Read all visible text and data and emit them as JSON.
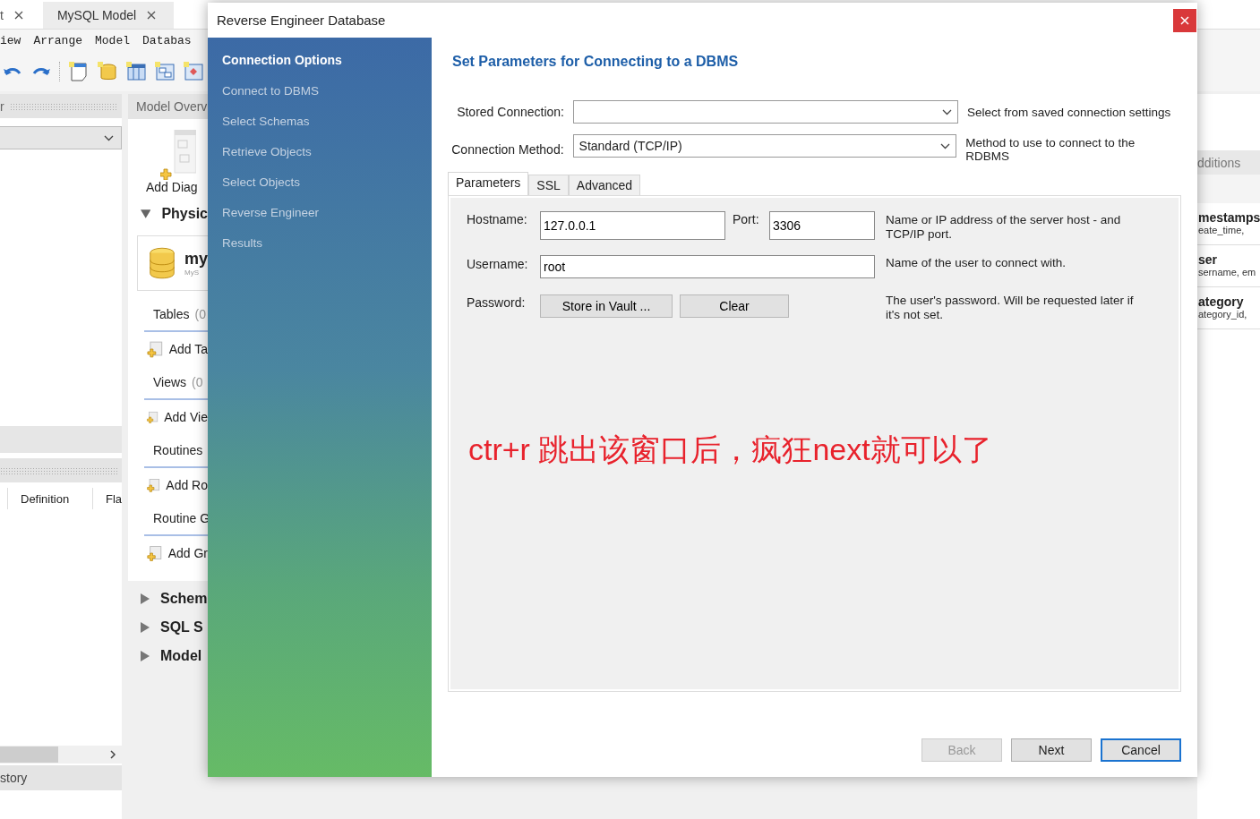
{
  "app": {
    "doc_tabs": [
      {
        "label": "t",
        "selected": false
      },
      {
        "label": "MySQL Model",
        "selected": true
      }
    ],
    "menu": [
      "iew",
      "Arrange",
      "Model",
      "Databas"
    ],
    "left_panel": {
      "header": "r",
      "columns": [
        "Definition",
        "Fla"
      ],
      "bottom_tab": "story"
    },
    "overview": {
      "header": "Model Overv",
      "add_diagram": "Add Diag",
      "sections": [
        {
          "label": "Physic",
          "expanded": true
        },
        {
          "label": "Schem",
          "expanded": false
        },
        {
          "label": "SQL S",
          "expanded": false
        },
        {
          "label": "Model",
          "expanded": false
        }
      ],
      "schema": {
        "name": "my",
        "subtitle": "MyS"
      },
      "groups": [
        {
          "label": "Tables",
          "count": "(0",
          "add": "Add Ta"
        },
        {
          "label": "Views",
          "count": "(0",
          "add": "Add Vie"
        },
        {
          "label": "Routines",
          "add": "Add Ro"
        },
        {
          "label": "Routine G",
          "add": "Add Gr"
        }
      ]
    },
    "right_panel": {
      "header": "dditions",
      "items": [
        {
          "title": "mestamps",
          "detail": "eate_time,"
        },
        {
          "title": "ser",
          "detail": "sername, em"
        },
        {
          "title": "ategory",
          "detail": "ategory_id,"
        }
      ]
    }
  },
  "dialog": {
    "title": "Reverse Engineer Database",
    "steps": [
      {
        "label": "Connection Options",
        "selected": true
      },
      {
        "label": "Connect to DBMS",
        "selected": false
      },
      {
        "label": "Select Schemas",
        "selected": false
      },
      {
        "label": "Retrieve Objects",
        "selected": false
      },
      {
        "label": "Select Objects",
        "selected": false
      },
      {
        "label": "Reverse Engineer",
        "selected": false
      },
      {
        "label": "Results",
        "selected": false
      }
    ],
    "heading": "Set Parameters for Connecting to a DBMS",
    "stored_connection": {
      "label": "Stored Connection:",
      "help": "Select from saved connection settings"
    },
    "connection_method": {
      "label": "Connection Method:",
      "value": "Standard (TCP/IP)",
      "help": "Method to use to connect to the RDBMS"
    },
    "tabs": [
      {
        "label": "Parameters",
        "selected": true
      },
      {
        "label": "SSL",
        "selected": false
      },
      {
        "label": "Advanced",
        "selected": false
      }
    ],
    "hostname": {
      "label": "Hostname:",
      "value": "127.0.0.1"
    },
    "port": {
      "label": "Port:",
      "value": "3306"
    },
    "host_help": "Name or IP address of the server host - and TCP/IP port.",
    "username": {
      "label": "Username:",
      "value": "root",
      "help": "Name of the user to connect with."
    },
    "password": {
      "label": "Password:",
      "buttons": [
        "Store in Vault ...",
        "Clear"
      ],
      "help": "The user's password. Will be requested later if it's not set."
    },
    "annotation": "ctr+r  跳出该窗口后，疯狂next就可以了",
    "buttons": [
      {
        "label": "Back",
        "disabled": true,
        "default": false
      },
      {
        "label": "Next",
        "disabled": false,
        "default": false
      },
      {
        "label": "Cancel",
        "disabled": false,
        "default": true
      }
    ]
  }
}
